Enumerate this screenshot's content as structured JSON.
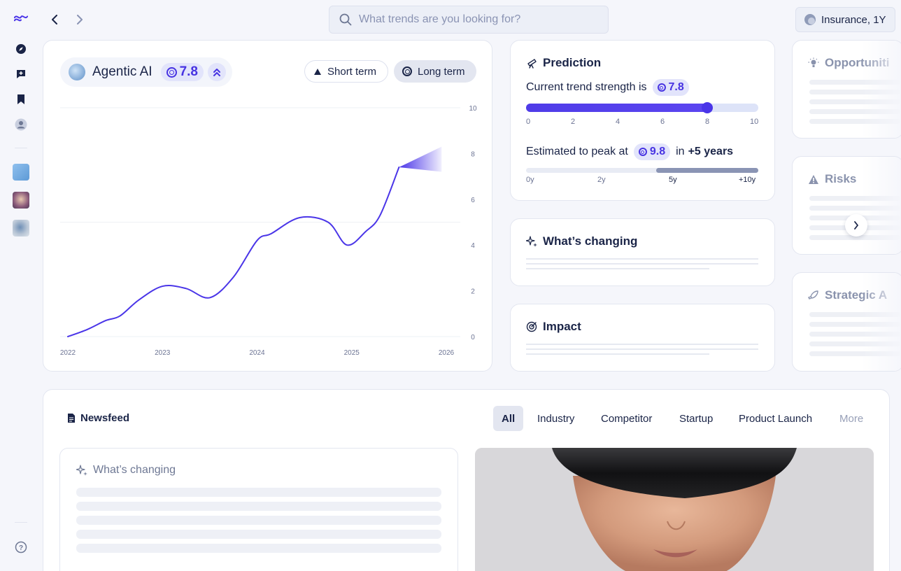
{
  "sidebar": {
    "icons": [
      "logo-icon",
      "compass-icon",
      "chat-add-icon",
      "bookmark-icon",
      "profile-icon",
      "help-icon"
    ],
    "thumbs": [
      "trend-thumb-1",
      "trend-thumb-2",
      "trend-thumb-3"
    ]
  },
  "topbar": {
    "search_placeholder": "What trends are you looking for?",
    "context_label": "Insurance, 1Y"
  },
  "trend": {
    "name": "Agentic AI",
    "score": "7.8",
    "short_term_label": "Short term",
    "long_term_label": "Long term",
    "selected_term": "Long term"
  },
  "chart_data": {
    "type": "line",
    "title": "",
    "xlabel": "",
    "ylabel": "",
    "x_ticks": [
      "2022",
      "2023",
      "2024",
      "2025",
      "2026"
    ],
    "y_ticks": [
      "10",
      "8",
      "6",
      "4",
      "2",
      "0"
    ],
    "ylim": [
      0,
      10
    ],
    "xlim": [
      2022,
      2026
    ],
    "series": [
      {
        "x": [
          2022.0,
          2022.2,
          2022.4,
          2022.55,
          2022.75,
          2023.0,
          2023.25,
          2023.5,
          2023.75,
          2024.0,
          2024.15,
          2024.45,
          2024.75,
          2024.95,
          2025.15,
          2025.3,
          2025.5
        ],
        "y": [
          0.0,
          0.3,
          0.7,
          0.9,
          1.6,
          2.2,
          2.1,
          1.7,
          2.6,
          4.2,
          4.5,
          5.2,
          5.0,
          4.0,
          4.6,
          5.3,
          7.4
        ]
      }
    ],
    "projection": {
      "x_start": 2025.5,
      "x_end": 2025.95,
      "y_start": 7.4,
      "y_upper": 8.3,
      "y_lower": 7.2
    },
    "grid": true
  },
  "prediction": {
    "title": "Prediction",
    "strength_prefix": "Current trend strength is",
    "strength_value": "7.8",
    "strength_fraction": 0.78,
    "scale_ticks": [
      "0",
      "2",
      "4",
      "6",
      "8",
      "10"
    ],
    "peak_prefix": "Estimated to peak at",
    "peak_value": "9.8",
    "peak_in": "in",
    "peak_when": "+5 years",
    "peak_ticks": [
      "0y",
      "2y",
      "5y",
      "+10y"
    ]
  },
  "whats_changing": {
    "title": "What’s changing"
  },
  "impact": {
    "title": "Impact"
  },
  "side_cards": {
    "opportunities": "Opportuniti",
    "risks": "Risks",
    "strategic": "Strategic A"
  },
  "newsfeed": {
    "title": "Newsfeed",
    "tabs": [
      "All",
      "Industry",
      "Competitor",
      "Startup",
      "Product Launch",
      "More"
    ],
    "active_tab": "All",
    "card_title": "What’s changing"
  }
}
